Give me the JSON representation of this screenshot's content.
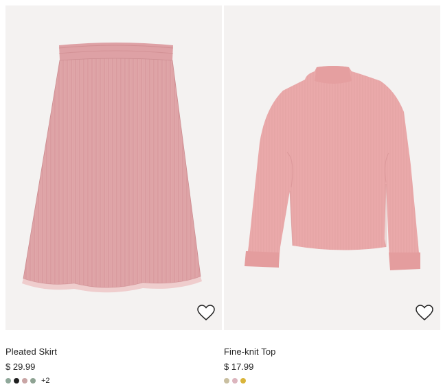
{
  "products": [
    {
      "name": "Pleated Skirt",
      "price": "$ 29.99",
      "swatches": [
        "#8fa89a",
        "#1f1f1f",
        "#c9a5a5",
        "#8ea393"
      ],
      "more_colors": "+2",
      "image_icon": "pleated-skirt-image",
      "favorite_icon": "heart-outline-icon"
    },
    {
      "name": "Fine-knit Top",
      "price": "$ 17.99",
      "swatches": [
        "#c9bfa0",
        "#dcb5be",
        "#d9b43a"
      ],
      "more_colors": "",
      "image_icon": "knit-top-image",
      "favorite_icon": "heart-outline-icon"
    }
  ],
  "colors": {
    "image_background": "#f4f2f1",
    "skirt_pink": "#e2a8ab",
    "top_pink": "#e9a7a8"
  }
}
